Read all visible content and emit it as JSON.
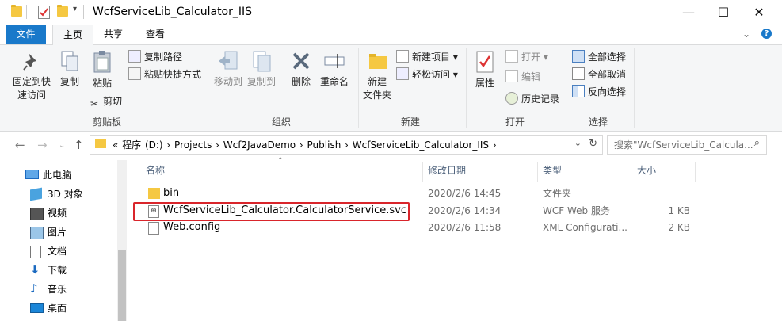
{
  "window": {
    "title": "WcfServiceLib_Calculator_IIS",
    "minimize": "—",
    "maximize": "☐",
    "close": "✕"
  },
  "tabs": {
    "file": "文件",
    "home": "主页",
    "share": "共享",
    "view": "查看"
  },
  "ribbon": {
    "clipboard": {
      "label": "剪贴板",
      "pin_line1": "固定到快",
      "pin_line2": "速访问",
      "copy": "复制",
      "paste": "粘贴",
      "copy_path": "复制路径",
      "paste_shortcut": "粘贴快捷方式",
      "cut": "剪切"
    },
    "organize": {
      "label": "组织",
      "move_to": "移动到",
      "copy_to": "复制到",
      "delete": "删除",
      "rename": "重命名"
    },
    "new": {
      "label": "新建",
      "new_folder_line1": "新建",
      "new_folder_line2": "文件夹",
      "new_item": "新建项目",
      "easy_access": "轻松访问"
    },
    "open": {
      "label": "打开",
      "properties": "属性",
      "open": "打开",
      "edit": "编辑",
      "history": "历史记录"
    },
    "select": {
      "label": "选择",
      "select_all": "全部选择",
      "select_none": "全部取消",
      "invert": "反向选择"
    }
  },
  "address": {
    "path_display": "«  程序 (D:)  ›  Projects  ›  Wcf2JavaDemo  ›  Publish  ›  WcfServiceLib_Calculator_IIS  ›",
    "search_placeholder": "搜索\"WcfServiceLib_Calcula..."
  },
  "nav_pane": {
    "items": [
      {
        "label": "此电脑",
        "icon": "computer-icon"
      },
      {
        "label": "3D 对象",
        "icon": "cube-icon"
      },
      {
        "label": "视频",
        "icon": "video-icon"
      },
      {
        "label": "图片",
        "icon": "picture-icon"
      },
      {
        "label": "文档",
        "icon": "document-icon"
      },
      {
        "label": "下载",
        "icon": "download-icon"
      },
      {
        "label": "音乐",
        "icon": "music-icon"
      },
      {
        "label": "桌面",
        "icon": "desktop-icon"
      }
    ]
  },
  "columns": {
    "name": "名称",
    "date": "修改日期",
    "type": "类型",
    "size": "大小"
  },
  "files": [
    {
      "name": "bin",
      "date": "2020/2/6 14:45",
      "type": "文件夹",
      "size": "",
      "icon": "folder-icon"
    },
    {
      "name": "WcfServiceLib_Calculator.CalculatorService.svc",
      "date": "2020/2/6 14:34",
      "type": "WCF Web 服务",
      "size": "1 KB",
      "icon": "svc-file-icon"
    },
    {
      "name": "Web.config",
      "date": "2020/2/6 11:58",
      "type": "XML Configurati...",
      "size": "2 KB",
      "icon": "config-file-icon"
    }
  ],
  "colors": {
    "accent": "#1979ca",
    "highlight_border": "#d9252b",
    "folder": "#f5c842"
  }
}
